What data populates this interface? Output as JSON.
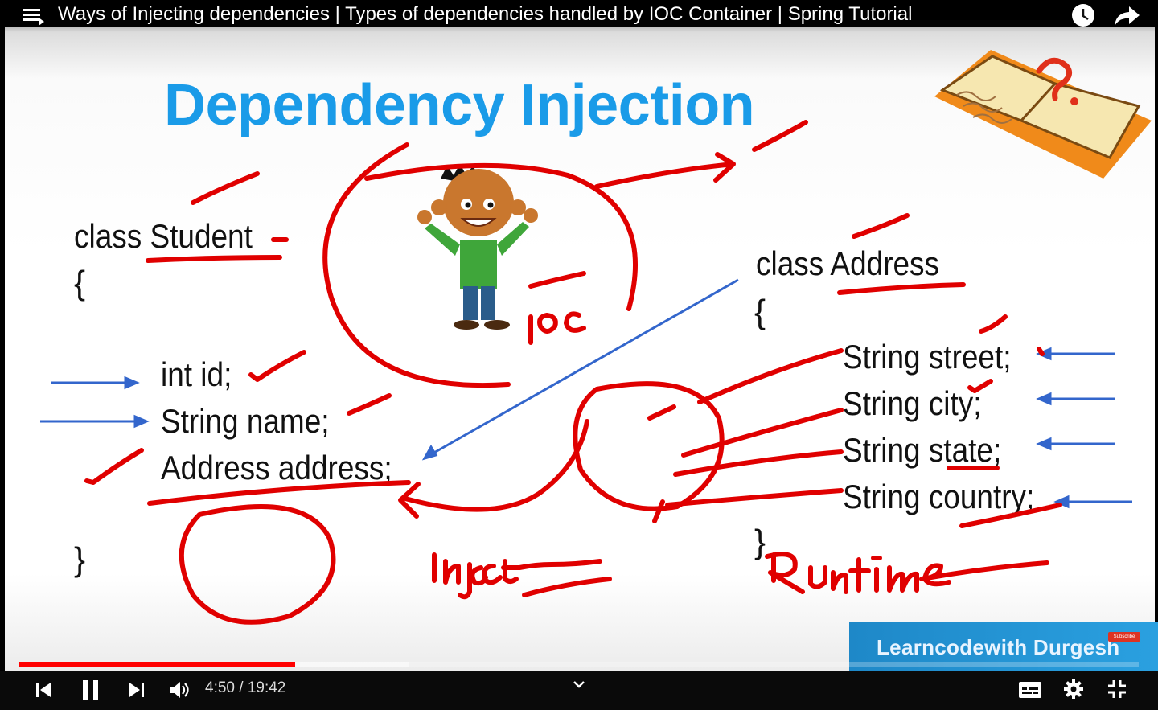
{
  "player": {
    "title": "Ways of Injecting dependencies | Types of dependencies handled by IOC Container | Spring Tutorial",
    "current_time": "4:50",
    "duration": "19:42",
    "time_display": "4:50 / 19:42",
    "played_fraction": 0.2461,
    "buffered_fraction": 0.3484,
    "progress_color": "#ff0000"
  },
  "slide": {
    "heading": "Dependency Injection",
    "student": {
      "class_line": "class Student",
      "open_brace": "{",
      "fields": [
        "int id;",
        "String name;",
        "Address address;"
      ],
      "close_brace": "}"
    },
    "address": {
      "class_line": "class Address",
      "open_brace": "{",
      "fields": [
        "String street;",
        "String city;",
        "String state;",
        "String country;"
      ],
      "close_brace": "}"
    },
    "annotations": [
      "IOC",
      "inject",
      "Runtime"
    ],
    "heading_color": "#1a9be8",
    "ink_color": "#e00000",
    "arrow_color": "#3366cc"
  },
  "branding": {
    "channel": "Learncodewith Durgesh",
    "badge": "Subscribe"
  },
  "icons": {
    "menu": "playlist-menu-icon",
    "watch_later": "clock-icon",
    "share": "share-icon",
    "prev": "previous-icon",
    "pause": "pause-icon",
    "next": "next-icon",
    "volume": "volume-icon",
    "chevron": "chevron-down-icon",
    "captions": "captions-icon",
    "settings": "gear-icon",
    "exit_fullscreen": "exit-fullscreen-icon"
  }
}
